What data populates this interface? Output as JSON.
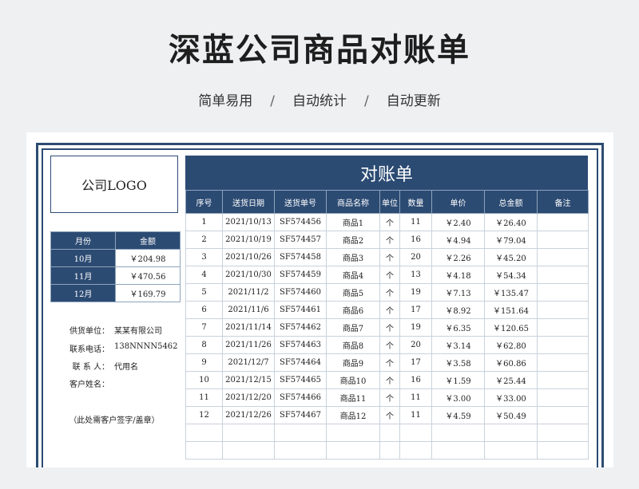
{
  "banner": {
    "title": "深蓝公司商品对账单",
    "subtitle": [
      "简单易用",
      "自动统计",
      "自动更新"
    ],
    "separator": "/"
  },
  "logo": "公司LOGO",
  "sheet_title": "对账单",
  "monthly": {
    "headers": [
      "月份",
      "金额"
    ],
    "rows": [
      {
        "month": "10月",
        "amount": "￥204.98"
      },
      {
        "month": "11月",
        "amount": "￥470.56"
      },
      {
        "month": "12月",
        "amount": "￥169.79"
      }
    ]
  },
  "info": [
    {
      "label": "供货单位：",
      "value": "某某有限公司"
    },
    {
      "label": "联系电话：",
      "value": "138NNNN5462"
    },
    {
      "label": "联 系 人：",
      "value": "代用名"
    },
    {
      "label": "客户姓名：",
      "value": ""
    }
  ],
  "signature_note": "（此处需客户签字/盖章）",
  "table": {
    "headers": [
      "序号",
      "送货日期",
      "送货单号",
      "商品名称",
      "单位",
      "数量",
      "单价",
      "总金额",
      "备注"
    ],
    "rows": [
      [
        "1",
        "2021/10/13",
        "SF574456",
        "商品1",
        "个",
        "11",
        "￥2.40",
        "￥26.40",
        ""
      ],
      [
        "2",
        "2021/10/19",
        "SF574457",
        "商品2",
        "个",
        "16",
        "￥4.94",
        "￥79.04",
        ""
      ],
      [
        "3",
        "2021/10/26",
        "SF574458",
        "商品3",
        "个",
        "20",
        "￥2.26",
        "￥45.20",
        ""
      ],
      [
        "4",
        "2021/10/30",
        "SF574459",
        "商品4",
        "个",
        "13",
        "￥4.18",
        "￥54.34",
        ""
      ],
      [
        "5",
        "2021/11/2",
        "SF574460",
        "商品5",
        "个",
        "19",
        "￥7.13",
        "￥135.47",
        ""
      ],
      [
        "6",
        "2021/11/6",
        "SF574461",
        "商品6",
        "个",
        "17",
        "￥8.92",
        "￥151.64",
        ""
      ],
      [
        "7",
        "2021/11/14",
        "SF574462",
        "商品7",
        "个",
        "19",
        "￥6.35",
        "￥120.65",
        ""
      ],
      [
        "8",
        "2021/11/26",
        "SF574463",
        "商品8",
        "个",
        "20",
        "￥3.14",
        "￥62.80",
        ""
      ],
      [
        "9",
        "2021/12/7",
        "SF574464",
        "商品9",
        "个",
        "17",
        "￥3.58",
        "￥60.86",
        ""
      ],
      [
        "10",
        "2021/12/15",
        "SF574465",
        "商品10",
        "个",
        "16",
        "￥1.59",
        "￥25.44",
        ""
      ],
      [
        "11",
        "2021/12/20",
        "SF574466",
        "商品11",
        "个",
        "11",
        "￥3.00",
        "￥33.00",
        ""
      ],
      [
        "12",
        "2021/12/26",
        "SF574467",
        "商品12",
        "个",
        "11",
        "￥4.59",
        "￥50.49",
        ""
      ],
      [
        "",
        "",
        "",
        "",
        "",
        "",
        "",
        "",
        ""
      ],
      [
        "",
        "",
        "",
        "",
        "",
        "",
        "",
        "",
        ""
      ]
    ]
  }
}
